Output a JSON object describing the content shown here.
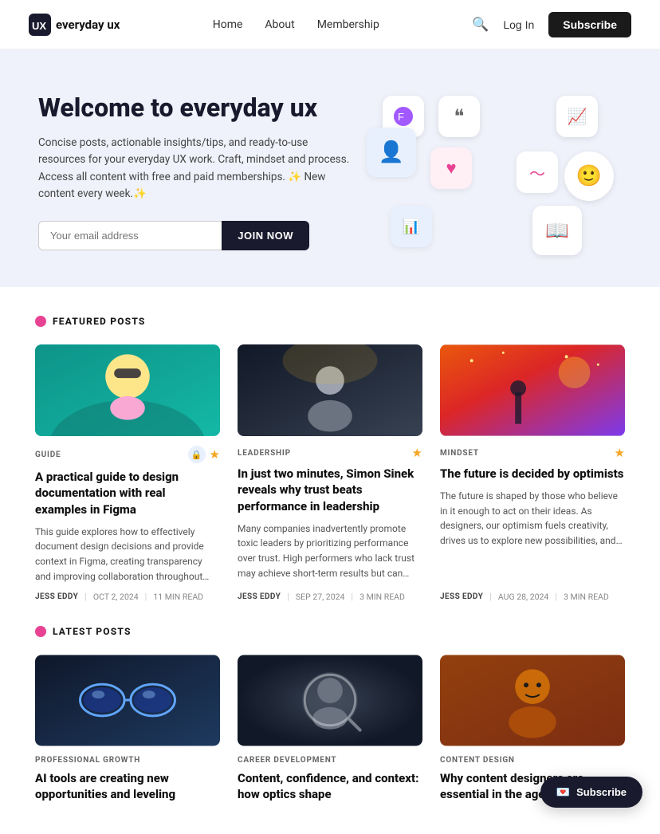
{
  "nav": {
    "logo_text": "everyday ux",
    "links": [
      {
        "label": "Home",
        "key": "home"
      },
      {
        "label": "About",
        "key": "about"
      },
      {
        "label": "Membership",
        "key": "membership"
      }
    ],
    "log_in_label": "Log In",
    "subscribe_label": "Subscribe"
  },
  "hero": {
    "title": "Welcome to everyday ux",
    "description": "Concise posts, actionable insights/tips, and ready-to-use resources for your everyday UX work. Craft, mindset and process. Access all content with free and paid memberships. ✨ New content every week.✨",
    "email_placeholder": "Your email address",
    "join_label": "JOIN NOW"
  },
  "featured": {
    "section_label": "FEATURED POSTS",
    "posts": [
      {
        "category": "GUIDE",
        "has_lock": true,
        "has_star": true,
        "title": "A practical guide to design documentation with real examples in Figma",
        "excerpt": "This guide explores how to effectively document design decisions and provide context in Figma, creating transparency and improving collaboration throughout your design process. Discover how to establish a single source of truth, minimize miscommunication, and improve team alignment and efficiency.",
        "author": "JESS EDDY",
        "date": "OCT 2, 2024",
        "read_time": "11 MIN READ",
        "image_class": "img-teal"
      },
      {
        "category": "LEADERSHIP",
        "has_lock": false,
        "has_star": true,
        "title": "In just two minutes, Simon Sinek reveals why trust beats performance in leadership",
        "excerpt": "Many companies inadvertently promote toxic leaders by prioritizing performance over trust. High performers who lack trust may achieve short-term results but can harm team morale and long-term success. Businesses should prioritize trust as much as performance when building strong teams.",
        "author": "JESS EDDY",
        "date": "SEP 27, 2024",
        "read_time": "3 MIN READ",
        "image_class": "img-dark"
      },
      {
        "category": "MINDSET",
        "has_lock": false,
        "has_star": true,
        "title": "The future is decided by optimists",
        "excerpt": "The future is shaped by those who believe in it enough to act on their ideas. As designers, our optimism fuels creativity, drives us to explore new possibilities, and enables us to envision and create better experiences, even when the path isn't clear.",
        "author": "JESS EDDY",
        "date": "AUG 28, 2024",
        "read_time": "3 MIN READ",
        "image_class": "img-sunset"
      }
    ]
  },
  "latest": {
    "section_label": "LATEST POSTS",
    "posts": [
      {
        "category": "PROFESSIONAL GROWTH",
        "has_lock": false,
        "has_star": false,
        "title": "AI tools are creating new opportunities and leveling",
        "excerpt": "",
        "image_class": "img-blue-dark"
      },
      {
        "category": "CAREER DEVELOPMENT",
        "has_lock": false,
        "has_star": false,
        "title": "Content, confidence, and context: how optics shape",
        "excerpt": "",
        "image_class": "img-dark-circle"
      },
      {
        "category": "CONTENT DESIGN",
        "has_lock": false,
        "has_star": false,
        "title": "Why content designers are essential in the age of AI",
        "excerpt": "",
        "image_class": "img-warm"
      }
    ]
  },
  "subscribe_float_label": "Subscribe"
}
